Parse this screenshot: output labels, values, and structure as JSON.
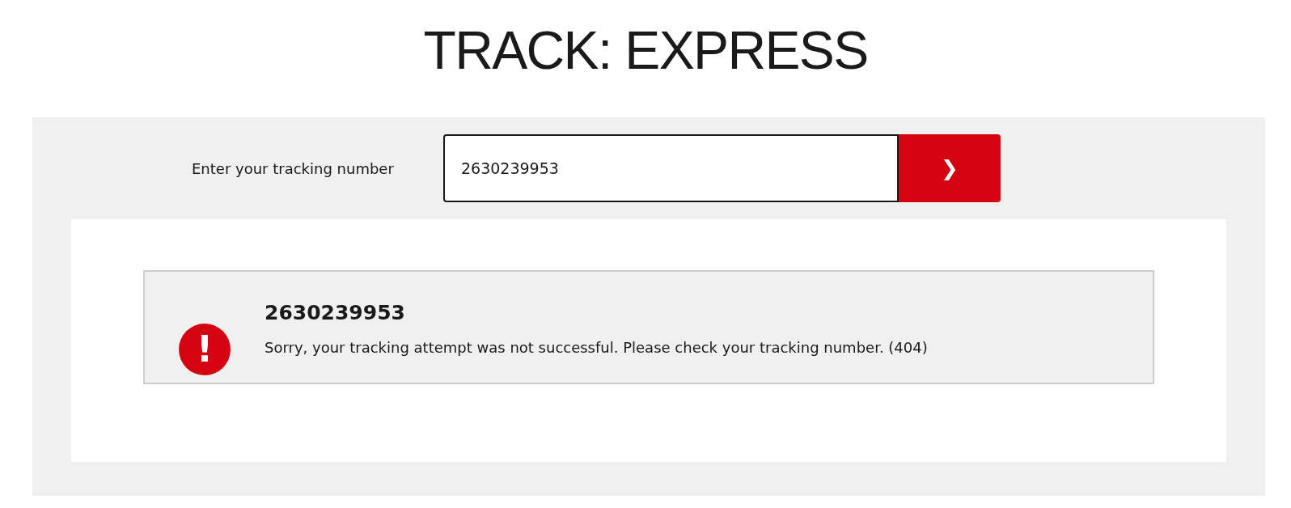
{
  "title": "TRACK: EXPRESS",
  "search": {
    "label": "Enter your tracking number",
    "value": "2630239953",
    "button": "❯"
  },
  "result": {
    "number": "2630239953",
    "icon": "!",
    "message": "Sorry, your tracking attempt was not successful. Please check your tracking number. (404)"
  }
}
